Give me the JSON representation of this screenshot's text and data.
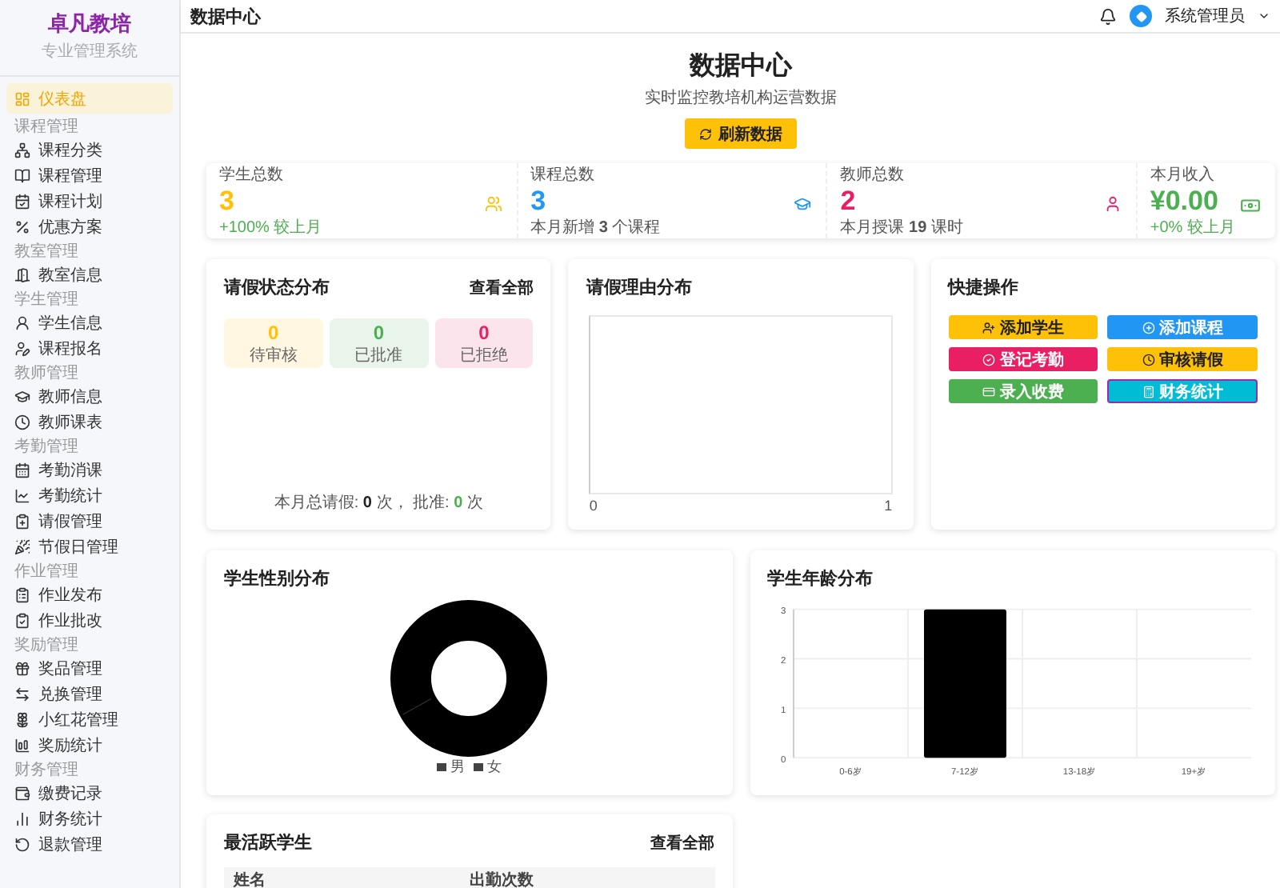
{
  "brand": {
    "title": "卓凡教培",
    "subtitle": "专业管理系统"
  },
  "nav": {
    "top_item": {
      "label": "仪表盘",
      "selected": true
    },
    "sections": [
      {
        "title": "课程管理",
        "items": [
          {
            "label": "课程分类",
            "selected": false
          },
          {
            "label": "课程管理",
            "selected": false
          },
          {
            "label": "课程计划",
            "selected": false
          },
          {
            "label": "优惠方案",
            "selected": false
          }
        ]
      },
      {
        "title": "教室管理",
        "items": [
          {
            "label": "教室信息",
            "selected": false
          }
        ]
      },
      {
        "title": "学生管理",
        "items": [
          {
            "label": "学生信息",
            "selected": false
          },
          {
            "label": "课程报名",
            "selected": false
          }
        ]
      },
      {
        "title": "教师管理",
        "items": [
          {
            "label": "教师信息",
            "selected": false
          },
          {
            "label": "教师课表",
            "selected": false
          }
        ]
      },
      {
        "title": "考勤管理",
        "items": [
          {
            "label": "考勤消课",
            "selected": false
          },
          {
            "label": "考勤统计",
            "selected": false
          },
          {
            "label": "请假管理",
            "selected": false
          },
          {
            "label": "节假日管理",
            "selected": false
          }
        ]
      },
      {
        "title": "作业管理",
        "items": [
          {
            "label": "作业发布",
            "selected": false
          },
          {
            "label": "作业批改",
            "selected": false
          }
        ]
      },
      {
        "title": "奖励管理",
        "items": [
          {
            "label": "奖品管理",
            "selected": false
          },
          {
            "label": "兑换管理",
            "selected": false
          },
          {
            "label": "小红花管理",
            "selected": false
          },
          {
            "label": "奖励统计",
            "selected": false
          }
        ]
      },
      {
        "title": "财务管理",
        "items": [
          {
            "label": "缴费记录",
            "selected": false
          },
          {
            "label": "财务统计",
            "selected": false
          },
          {
            "label": "退款管理",
            "selected": false
          }
        ]
      }
    ]
  },
  "header": {
    "title": "数据中心",
    "user": "系统管理员"
  },
  "hero": {
    "title": "数据中心",
    "subtitle": "实时监控教培机构运营数据",
    "button": "刷新数据"
  },
  "stats": [
    {
      "label": "学生总数",
      "value": "3",
      "color": "#ffc107",
      "note": "+100% 较上月",
      "positive": true
    },
    {
      "label": "课程总数",
      "value": "3",
      "color": "#2196f3",
      "note": "本月新增 **3** 个课程",
      "positive": false
    },
    {
      "label": "教师总数",
      "value": "2",
      "color": "#e91e63",
      "note": "本月授课 **19** 课时",
      "positive": false
    },
    {
      "label": "本月收入",
      "value": "¥0.00",
      "color": "#4caf50",
      "note": "+0% 较上月",
      "positive": true
    }
  ],
  "leave_status": {
    "title": "请假状态分布",
    "link": "查看全部",
    "items": [
      {
        "count": "0",
        "label": "待审核",
        "color": "#ffc107"
      },
      {
        "count": "0",
        "label": "已批准",
        "color": "#4caf50"
      },
      {
        "count": "0",
        "label": "已拒绝",
        "color": "#e91e63"
      }
    ],
    "summary": {
      "prefix": "本月总请假:",
      "total": "0",
      "mid": "次， 批准:",
      "approved": "0",
      "suffix": "次"
    }
  },
  "leave_reasons": {
    "title": "请假理由分布",
    "axis_ticks": [
      "0",
      "1"
    ]
  },
  "quick_actions": {
    "title": "快捷操作",
    "buttons": [
      {
        "label": "添加学生",
        "color": "#ffc107",
        "focused": false
      },
      {
        "label": "添加课程",
        "color": "#2196f3",
        "focused": false
      },
      {
        "label": "登记考勤",
        "color": "#e91e63",
        "focused": false
      },
      {
        "label": "审核请假",
        "color": "#ffc107",
        "focused": false
      },
      {
        "label": "录入收费",
        "color": "#4caf50",
        "focused": false
      },
      {
        "label": "财务统计",
        "color": "#00bcd4",
        "focused": true
      }
    ]
  },
  "gender": {
    "title": "学生性别分布",
    "legend": [
      "男",
      "女"
    ]
  },
  "age": {
    "title": "学生年龄分布",
    "chart_data": {
      "type": "bar",
      "categories": [
        "0-6岁",
        "7-12岁",
        "13-18岁",
        "19+岁"
      ],
      "values": [
        0,
        3,
        0,
        0
      ],
      "ylim": [
        0,
        3
      ],
      "yticks": [
        0,
        1,
        2,
        3
      ]
    }
  },
  "active_students": {
    "title": "最活跃学生",
    "link": "查看全部",
    "columns": [
      "姓名",
      "出勤次数"
    ]
  }
}
